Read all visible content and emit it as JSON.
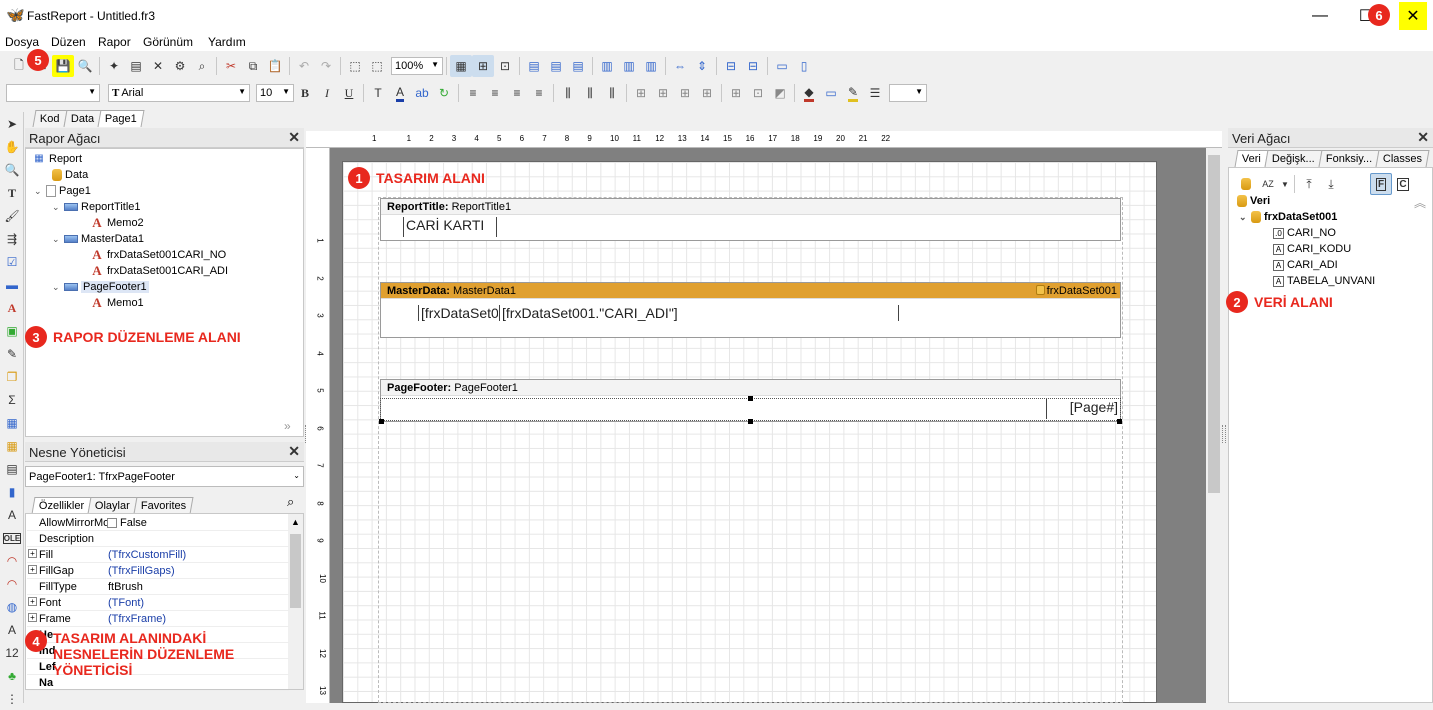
{
  "window": {
    "title": "FastReport - Untitled.fr3",
    "minimize": "—",
    "maximize": "☐",
    "close": "✕"
  },
  "menu": [
    "Dosya",
    "Düzen",
    "Rapor",
    "Görünüm",
    "Yardım"
  ],
  "toolbar": {
    "zoom": "100%",
    "font_name": "Arial",
    "font_size": "10",
    "bold": "B",
    "italic": "I",
    "underline": "U"
  },
  "doc_tabs": [
    "Kod",
    "Data",
    "Page1"
  ],
  "report_tree": {
    "title": "Rapor Ağacı",
    "nodes": [
      {
        "label": "Report",
        "icon": "report-icon"
      },
      {
        "label": "Data",
        "icon": "database-icon"
      },
      {
        "label": "Page1",
        "icon": "page-icon"
      },
      {
        "label": "ReportTitle1",
        "icon": "band-icon"
      },
      {
        "label": "Memo2",
        "icon": "text-memo-icon"
      },
      {
        "label": "MasterData1",
        "icon": "band-icon"
      },
      {
        "label": "frxDataSet001CARI_NO",
        "icon": "text-memo-icon"
      },
      {
        "label": "frxDataSet001CARI_ADI",
        "icon": "text-memo-icon"
      },
      {
        "label": "PageFooter1",
        "icon": "band-icon"
      },
      {
        "label": "Memo1",
        "icon": "text-memo-icon"
      }
    ]
  },
  "object_inspector": {
    "title": "Nesne Yöneticisi",
    "selected": "PageFooter1: TfrxPageFooter",
    "tabs": [
      "Özellikler",
      "Olaylar",
      "Favorites"
    ],
    "rows": [
      {
        "name": "AllowMirrorMo",
        "value": "False",
        "expandable": false
      },
      {
        "name": "Description",
        "value": "",
        "expandable": false
      },
      {
        "name": "Fill",
        "value": "(TfrxCustomFill)",
        "expandable": true
      },
      {
        "name": "FillGap",
        "value": "(TfrxFillGaps)",
        "expandable": true
      },
      {
        "name": "FillType",
        "value": "ftBrush",
        "expandable": false
      },
      {
        "name": "Font",
        "value": "(TFont)",
        "expandable": true
      },
      {
        "name": "Frame",
        "value": "(TfrxFrame)",
        "expandable": true
      },
      {
        "name": "He",
        "value": "",
        "expandable": false
      },
      {
        "name": "Ind",
        "value": "",
        "expandable": false
      },
      {
        "name": "Lef",
        "value": "",
        "expandable": false
      },
      {
        "name": "Na",
        "value": "",
        "expandable": false
      }
    ]
  },
  "design": {
    "bands": [
      {
        "type": "ReportTitle:",
        "name": "ReportTitle1",
        "memo": "CARİ KARTI"
      },
      {
        "type": "MasterData:",
        "name": "MasterData1",
        "dataset": "frxDataSet001",
        "memo_a": "[frxDataSet0",
        "memo_b": "[frxDataSet001.\"CARI_ADI\"]"
      },
      {
        "type": "PageFooter:",
        "name": "PageFooter1",
        "memo": "[Page#]"
      }
    ]
  },
  "data_tree": {
    "title": "Veri Ağacı",
    "tabs": [
      "Veri",
      "Değişk...",
      "Fonksiy...",
      "Classes"
    ],
    "root": "Veri",
    "dataset": "frxDataSet001",
    "fields": [
      "CARI_NO",
      "CARI_KODU",
      "CARI_ADI",
      "TABELA_UNVANI"
    ]
  },
  "annotations": [
    {
      "num": "1",
      "text": "TASARIM ALANI"
    },
    {
      "num": "2",
      "text": "VERİ ALANI"
    },
    {
      "num": "3",
      "text": "RAPOR DÜZENLEME ALANI"
    },
    {
      "num": "4",
      "text": "TASARIM ALANINDAKİ NESNELERİN DÜZENLEME YÖNETİCİSİ"
    },
    {
      "num": "5",
      "text": ""
    },
    {
      "num": "6",
      "text": ""
    }
  ],
  "ruler_top": [
    "1",
    "1",
    "2",
    "3",
    "4",
    "5",
    "6",
    "7",
    "8",
    "9",
    "10",
    "11",
    "12",
    "13",
    "14",
    "15",
    "16",
    "17",
    "18",
    "19",
    "20",
    "21",
    "22"
  ],
  "ruler_left": [
    "1",
    "2",
    "3",
    "4",
    "5",
    "6",
    "7",
    "8",
    "9",
    "10",
    "11",
    "12",
    "13"
  ],
  "colors": {
    "accent": "#e8281e",
    "highlight": "#ffff00",
    "masterdata_header": "#e0a030"
  }
}
